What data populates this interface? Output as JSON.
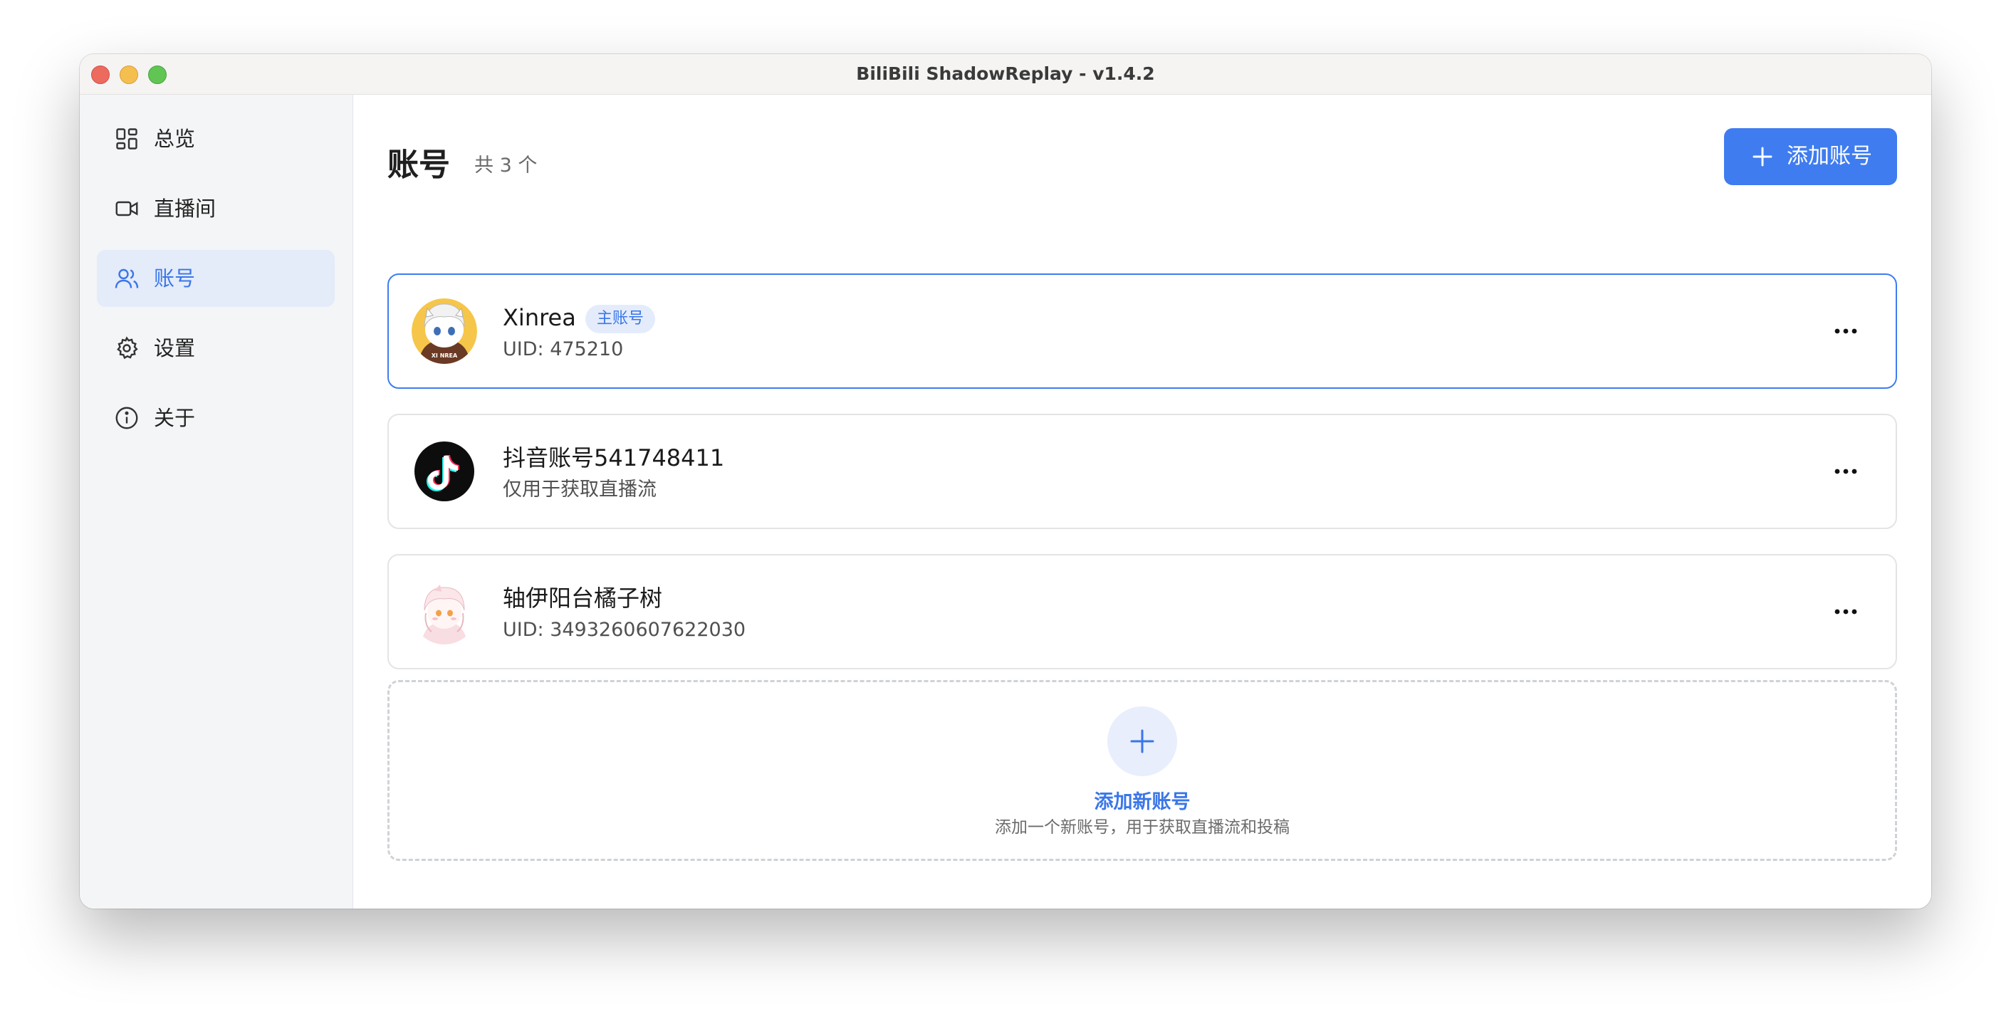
{
  "window": {
    "title": "BiliBili ShadowReplay - v1.4.2"
  },
  "sidebar": {
    "items": [
      {
        "label": "总览",
        "icon": "dashboard-icon"
      },
      {
        "label": "直播间",
        "icon": "video-camera-icon"
      },
      {
        "label": "账号",
        "icon": "users-icon",
        "active": true
      },
      {
        "label": "设置",
        "icon": "gear-icon"
      },
      {
        "label": "关于",
        "icon": "info-icon"
      }
    ]
  },
  "header": {
    "title": "账号",
    "count": "共 3 个",
    "add_button": "添加账号"
  },
  "accounts": [
    {
      "name": "Xinrea",
      "badge": "主账号",
      "sub": "UID: 475210",
      "avatar": "anime-avatar-yellow",
      "selected": true
    },
    {
      "name": "抖音账号541748411",
      "sub": "仅用于获取直播流",
      "avatar": "douyin-logo"
    },
    {
      "name": "轴伊阳台橘子树",
      "sub": "UID: 3493260607622030",
      "avatar": "anime-avatar-pink"
    }
  ],
  "add_card": {
    "title": "添加新账号",
    "subtitle": "添加一个新账号，用于获取直播流和投稿"
  },
  "colors": {
    "accent": "#3f7cf0",
    "active_bg": "#e4ebf9",
    "sidebar_bg": "#f4f5f7"
  }
}
